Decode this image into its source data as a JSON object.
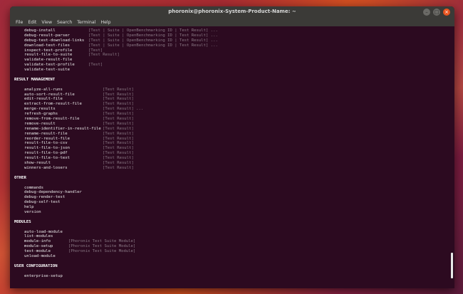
{
  "window": {
    "title": "phoronix@phoronix-System-Product-Name: ~",
    "menu": [
      "File",
      "Edit",
      "View",
      "Search",
      "Terminal",
      "Help"
    ]
  },
  "terminal": {
    "lines": [
      {
        "cmd": "debug-install",
        "args": "[Test | Suite | OpenBenchmarking ID | Test Result] ..."
      },
      {
        "cmd": "debug-result-parser",
        "args": "[Test | Suite | OpenBenchmarking ID | Test Result] ..."
      },
      {
        "cmd": "debug-test-download-links",
        "args": "[Test | Suite | OpenBenchmarking ID | Test Result] ..."
      },
      {
        "cmd": "download-test-files",
        "args": "[Test | Suite | OpenBenchmarking ID | Test Result] ..."
      },
      {
        "cmd": "inspect-test-profile",
        "args": "[Test]"
      },
      {
        "cmd": "result-file-to-suite",
        "args": "[Test Result]"
      },
      {
        "cmd": "validate-result-file",
        "args": ""
      },
      {
        "cmd": "validate-test-profile",
        "args": "[Test]"
      },
      {
        "cmd": "validate-test-suite",
        "args": ""
      },
      {
        "blank": true
      },
      {
        "header": "RESULT MANAGEMENT"
      },
      {
        "blank": true
      },
      {
        "cmd": "analyze-all-runs",
        "args": "[Test Result]",
        "wide": true
      },
      {
        "cmd": "auto-sort-result-file",
        "args": "[Test Result]",
        "wide": true
      },
      {
        "cmd": "edit-result-file",
        "args": "[Test Result]",
        "wide": true
      },
      {
        "cmd": "extract-from-result-file",
        "args": "[Test Result]",
        "wide": true
      },
      {
        "cmd": "merge-results",
        "args": "[Test Result] ...",
        "wide": true
      },
      {
        "cmd": "refresh-graphs",
        "args": "[Test Result]",
        "wide": true
      },
      {
        "cmd": "remove-from-result-file",
        "args": "[Test Result]",
        "wide": true
      },
      {
        "cmd": "remove-result",
        "args": "[Test Result]",
        "wide": true
      },
      {
        "cmd": "rename-identifier-in-result-file",
        "args": "[Test Result]",
        "wide": true
      },
      {
        "cmd": "rename-result-file",
        "args": "[Test Result]",
        "wide": true
      },
      {
        "cmd": "reorder-result-file",
        "args": "[Test Result]",
        "wide": true
      },
      {
        "cmd": "result-file-to-csv",
        "args": "[Test Result]",
        "wide": true
      },
      {
        "cmd": "result-file-to-json",
        "args": "[Test Result]",
        "wide": true
      },
      {
        "cmd": "result-file-to-pdf",
        "args": "[Test Result]",
        "wide": true
      },
      {
        "cmd": "result-file-to-text",
        "args": "[Test Result]",
        "wide": true
      },
      {
        "cmd": "show-result",
        "args": "[Test Result]",
        "wide": true
      },
      {
        "cmd": "winners-and-losers",
        "args": "[Test Result]",
        "wide": true
      },
      {
        "blank": true
      },
      {
        "header": "OTHER"
      },
      {
        "blank": true
      },
      {
        "cmd": "commands",
        "args": ""
      },
      {
        "cmd": "debug-dependency-handler",
        "args": ""
      },
      {
        "cmd": "debug-render-test",
        "args": ""
      },
      {
        "cmd": "debug-self-test",
        "args": ""
      },
      {
        "cmd": "help",
        "args": ""
      },
      {
        "cmd": "version",
        "args": ""
      },
      {
        "blank": true
      },
      {
        "header": "MODULES"
      },
      {
        "blank": true
      },
      {
        "cmd": "auto-load-module",
        "args": ""
      },
      {
        "cmd": "list-modules",
        "args": ""
      },
      {
        "cmd": "module-info",
        "args": "[Phoronix Test Suite Module]",
        "mid": true
      },
      {
        "cmd": "module-setup",
        "args": "[Phoronix Test Suite Module]",
        "mid": true
      },
      {
        "cmd": "test-module",
        "args": "[Phoronix Test Suite Module]",
        "mid": true
      },
      {
        "cmd": "unload-module",
        "args": ""
      },
      {
        "blank": true
      },
      {
        "header": "USER CONFIGURATION"
      },
      {
        "blank": true
      },
      {
        "cmd": "enterprise-setup",
        "args": ""
      }
    ]
  }
}
